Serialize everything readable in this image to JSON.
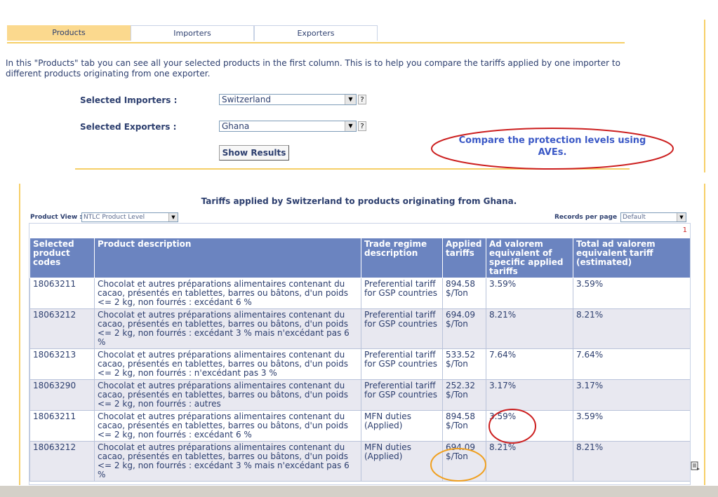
{
  "tabs": [
    {
      "label": "Products",
      "active": true
    },
    {
      "label": "Importers",
      "active": false
    },
    {
      "label": "Exporters",
      "active": false
    }
  ],
  "intro": "In this \"Products\" tab you can see all your selected products in the first column. This is to help you compare the tariffs applied by one importer to different products originating from one exporter.",
  "filters": {
    "importers_label": "Selected Importers :",
    "importers_value": "Switzerland",
    "exporters_label": "Selected Exporters :",
    "exporters_value": "Ghana",
    "help": "?",
    "show_results": "Show Results"
  },
  "annotation": "Compare the protection levels using AVEs.",
  "table": {
    "title": "Tariffs applied by Switzerland to products originating from Ghana.",
    "product_view_label": "Product View :",
    "product_view_value": "NTLC Product Level",
    "records_label": "Records per page",
    "records_value": "Default",
    "page_number": "1",
    "headers": [
      "Selected product codes",
      "Product description",
      "Trade regime description",
      "Applied tariffs",
      "Ad valorem equivalent of specific applied tariffs",
      "Total ad valorem equivalent tariff (estimated)"
    ],
    "rows": [
      {
        "code": "18063211",
        "desc": "Chocolat et autres préparations alimentaires contenant du cacao, présentés en tablettes, barres ou bâtons, d'un poids <= 2 kg, non fourrés : excédant 6 %",
        "regime": "Preferential tariff for GSP countries",
        "applied": "894.58 $/Ton",
        "ave": "3.59%",
        "total": "3.59%"
      },
      {
        "code": "18063212",
        "desc": "Chocolat et autres préparations alimentaires contenant du cacao, présentés en tablettes, barres ou bâtons, d'un poids <= 2 kg, non fourrés : excédant 3 % mais n'excédant pas 6 %",
        "regime": "Preferential tariff for GSP countries",
        "applied": "694.09 $/Ton",
        "ave": "8.21%",
        "total": "8.21%"
      },
      {
        "code": "18063213",
        "desc": "Chocolat et autres préparations alimentaires contenant du cacao, présentés en tablettes, barres ou bâtons, d'un poids <= 2 kg, non fourrés : n'excédant pas 3 %",
        "regime": "Preferential tariff for GSP countries",
        "applied": "533.52 $/Ton",
        "ave": "7.64%",
        "total": "7.64%"
      },
      {
        "code": "18063290",
        "desc": "Chocolat et autres préparations alimentaires contenant du cacao, présentés en tablettes, barres ou bâtons, d'un poids <= 2 kg, non fourrés : autres",
        "regime": "Preferential tariff for GSP countries",
        "applied": "252.32 $/Ton",
        "ave": "3.17%",
        "total": "3.17%"
      },
      {
        "code": "18063211",
        "desc": "Chocolat et autres préparations alimentaires contenant du cacao, présentés en tablettes, barres ou bâtons, d'un poids <= 2 kg, non fourrés : excédant 6 %",
        "regime": "MFN duties (Applied)",
        "applied": "894.58 $/Ton",
        "ave": "3.59%",
        "total": "3.59%"
      },
      {
        "code": "18063212",
        "desc": "Chocolat et autres préparations alimentaires contenant du cacao, présentés en tablettes, barres ou bâtons, d'un poids <= 2 kg, non fourrés : excédant 3 % mais n'excédant pas 6 %",
        "regime": "MFN duties (Applied)",
        "applied": "694.09 $/Ton",
        "ave": "8.21%",
        "total": "8.21%"
      }
    ]
  },
  "colors": {
    "accent": "#f6cf67",
    "header_bg": "#6b84c0",
    "annotation_red": "#cc1f1f",
    "annotation_orange": "#f0a020",
    "annotation_text": "#3a58c6"
  }
}
